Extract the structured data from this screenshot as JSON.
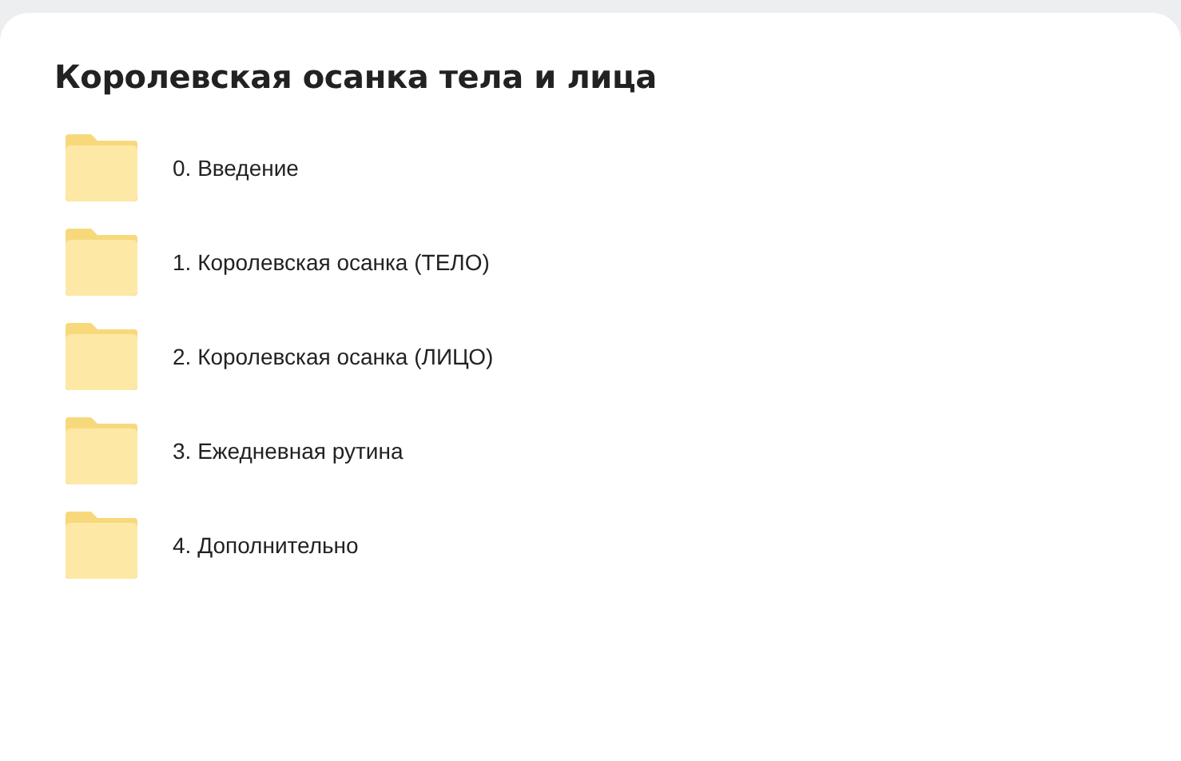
{
  "title": "Королевская осанка тела и лица",
  "folders": [
    {
      "name": "0. Введение"
    },
    {
      "name": "1. Королевская осанка (ТЕЛО)"
    },
    {
      "name": "2. Королевская осанка (ЛИЦО)"
    },
    {
      "name": "3. Ежедневная рутина"
    },
    {
      "name": "4. Дополнительно"
    }
  ]
}
